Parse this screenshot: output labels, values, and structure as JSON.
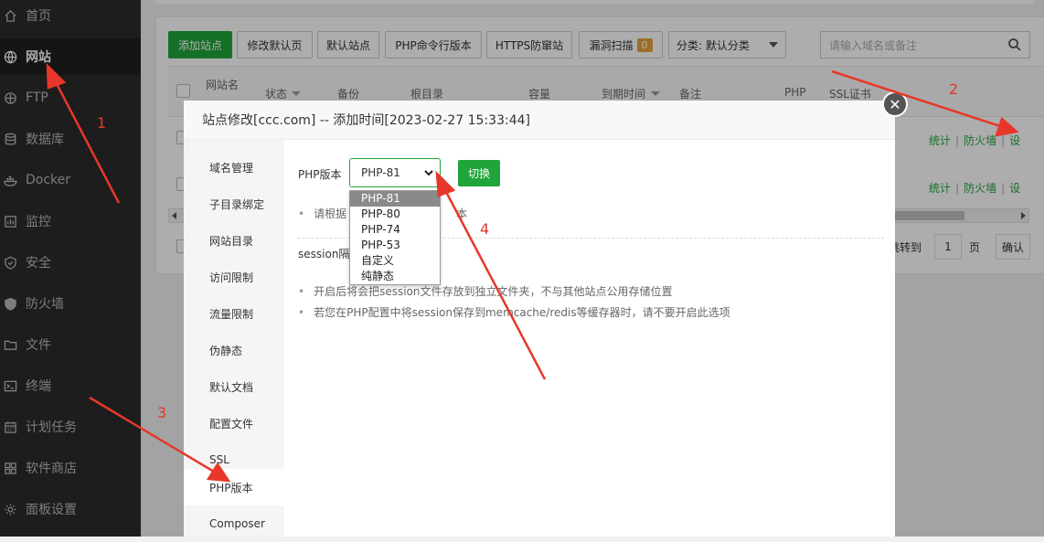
{
  "sidebar": {
    "items": [
      {
        "label": "首页",
        "icon": "home-icon"
      },
      {
        "label": "网站",
        "icon": "globe-icon"
      },
      {
        "label": "FTP",
        "icon": "ftp-icon"
      },
      {
        "label": "数据库",
        "icon": "database-icon"
      },
      {
        "label": "Docker",
        "icon": "docker-icon"
      },
      {
        "label": "监控",
        "icon": "monitor-icon"
      },
      {
        "label": "安全",
        "icon": "shield-icon"
      },
      {
        "label": "防火墙",
        "icon": "firewall-icon"
      },
      {
        "label": "文件",
        "icon": "folder-icon"
      },
      {
        "label": "终端",
        "icon": "terminal-icon"
      },
      {
        "label": "计划任务",
        "icon": "calendar-icon"
      },
      {
        "label": "软件商店",
        "icon": "grid-icon"
      },
      {
        "label": "面板设置",
        "icon": "gear-icon"
      }
    ]
  },
  "toolbar": {
    "add_site": "添加站点",
    "modify_default_page": "修改默认页",
    "default_site": "默认站点",
    "php_cli_version": "PHP命令行版本",
    "https_firewall": "HTTPS防窜站",
    "vuln_scan": "漏洞扫描",
    "vuln_count": "0",
    "category": "分类: 默认分类",
    "search_placeholder": "请输入域名或备注"
  },
  "table": {
    "headers": [
      "网站名",
      "状态",
      "备份",
      "根目录",
      "容量",
      "到期时间",
      "备注",
      "PHP",
      "SSL证书"
    ],
    "row_links": [
      "统计",
      "防火墙",
      "设"
    ]
  },
  "pager": {
    "jump_to": "跳转到",
    "page_value": "1",
    "page_unit": "页",
    "confirm": "确认"
  },
  "modal": {
    "title": "站点修改[ccc.com] -- 添加时间[2023-02-27 15:33:44]",
    "close_symbol": "✕",
    "nav": [
      "域名管理",
      "子目录绑定",
      "网站目录",
      "访问限制",
      "流量限制",
      "伪静态",
      "默认文档",
      "配置文件",
      "SSL",
      "PHP版本",
      "Composer"
    ],
    "php_label": "PHP版本",
    "php_selected": "PHP-81",
    "php_options": [
      "PHP-81",
      "PHP-80",
      "PHP-74",
      "PHP-53",
      "自定义",
      "纯静态"
    ],
    "switch_button": "切换",
    "tip1_start": "请根据",
    "tip1_end": "本",
    "session_label": "session隔离",
    "tip2": "开启后将会把session文件存放到独立文件夹，不与其他站点公用存储位置",
    "tip3": "若您在PHP配置中将session保存到memcache/redis等缓存器时，请不要开启此选项"
  },
  "annotations": [
    "1",
    "2",
    "3",
    "4"
  ],
  "colors": {
    "accent": "#20a53a",
    "annotation": "#e8372a",
    "sidebar_bg": "#2c2c2c"
  }
}
